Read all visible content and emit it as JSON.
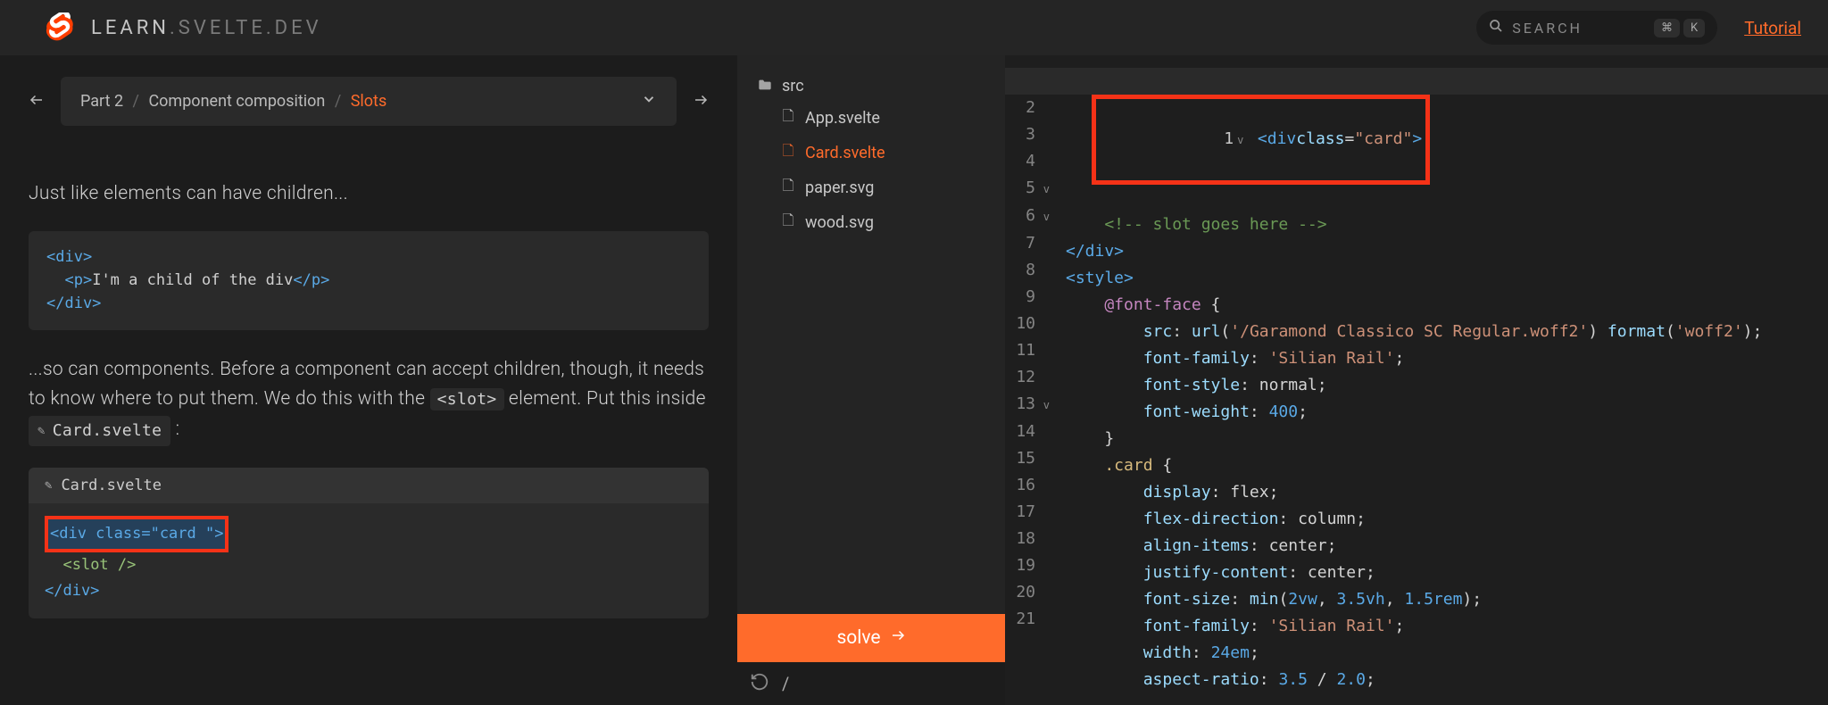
{
  "header": {
    "logo_bright": "LEARN",
    "logo_dim": ".SVELTE.DEV",
    "search_placeholder": "SEARCH",
    "kbd1": "⌘",
    "kbd2": "K",
    "tutorial_link": "Tutorial"
  },
  "breadcrumb": {
    "part": "Part 2",
    "section": "Component composition",
    "page": "Slots"
  },
  "tutorial": {
    "intro": "Just like elements can have children...",
    "code1_l1a": "<div>",
    "code1_l2a": "<p>",
    "code1_l2b": "I'm a child of the div",
    "code1_l2c": "</p>",
    "code1_l3a": "</div>",
    "para2_a": "...so can components. Before a component can accept children, though, it needs to know where to put them. We do this with the ",
    "para2_slot": "<slot>",
    "para2_b": " element. Put this inside ",
    "para2_file": "Card.svelte",
    "para2_c": " :",
    "file_header": "Card.svelte",
    "code2_l1": "<div class=\"card \">",
    "code2_l2": "<slot />",
    "code2_l3": "</div>"
  },
  "filetree": {
    "root": "src",
    "files": [
      "App.svelte",
      "Card.svelte",
      "paper.svg",
      "wood.svg"
    ],
    "active_index": 1
  },
  "solve_label": "solve",
  "url_path": "/",
  "editor": {
    "lines": [
      {
        "n": 1,
        "fold": "v",
        "cls": "cur"
      },
      {
        "n": 2,
        "fold": ""
      },
      {
        "n": 3,
        "fold": ""
      },
      {
        "n": 4,
        "fold": ""
      },
      {
        "n": 5,
        "fold": "v"
      },
      {
        "n": 6,
        "fold": "v"
      },
      {
        "n": 7,
        "fold": ""
      },
      {
        "n": 8,
        "fold": ""
      },
      {
        "n": 9,
        "fold": ""
      },
      {
        "n": 10,
        "fold": ""
      },
      {
        "n": 11,
        "fold": ""
      },
      {
        "n": 12,
        "fold": ""
      },
      {
        "n": 13,
        "fold": "v"
      },
      {
        "n": 14,
        "fold": ""
      },
      {
        "n": 15,
        "fold": ""
      },
      {
        "n": 16,
        "fold": ""
      },
      {
        "n": 17,
        "fold": ""
      },
      {
        "n": 18,
        "fold": ""
      },
      {
        "n": 19,
        "fold": ""
      },
      {
        "n": 20,
        "fold": ""
      },
      {
        "n": 21,
        "fold": ""
      }
    ],
    "code": {
      "l1": "<div class=\"card\">",
      "l2": "    <!-- slot goes here -->",
      "l3": "</div>",
      "l4": "",
      "l5": "<style>",
      "l6_a": "    @font-face",
      "l6_b": " {",
      "l7_a": "        src",
      "l7_b": ": ",
      "l7_c": "url",
      "l7_d": "(",
      "l7_e": "'/Garamond Classico SC Regular.woff2'",
      "l7_f": ") ",
      "l7_g": "format",
      "l7_h": "(",
      "l7_i": "'woff2'",
      "l7_j": ");",
      "l8_a": "        font-family",
      "l8_b": ": ",
      "l8_c": "'Silian Rail'",
      "l8_d": ";",
      "l9_a": "        font-style",
      "l9_b": ": normal;",
      "l10_a": "        font-weight",
      "l10_b": ": ",
      "l10_c": "400",
      "l10_d": ";",
      "l11": "    }",
      "l12": "",
      "l13_a": "    .card",
      "l13_b": " {",
      "l14_a": "        display",
      "l14_b": ": flex;",
      "l15_a": "        flex-direction",
      "l15_b": ": column;",
      "l16_a": "        align-items",
      "l16_b": ": center;",
      "l17_a": "        justify-content",
      "l17_b": ": center;",
      "l18_a": "        font-size",
      "l18_b": ": ",
      "l18_c": "min",
      "l18_d": "(",
      "l18_e": "2",
      "l18_f": "vw",
      "l18_g": ", ",
      "l18_h": "3.5",
      "l18_i": "vh",
      "l18_j": ", ",
      "l18_k": "1.5",
      "l18_l": "rem",
      "l18_m": ");",
      "l19_a": "        font-family",
      "l19_b": ": ",
      "l19_c": "'Silian Rail'",
      "l19_d": ";",
      "l20_a": "        width",
      "l20_b": ": ",
      "l20_c": "24",
      "l20_d": "em",
      "l20_e": ";",
      "l21_a": "        aspect-ratio",
      "l21_b": ": ",
      "l21_c": "3.5",
      "l21_d": " / ",
      "l21_e": "2.0",
      "l21_f": ";"
    }
  }
}
